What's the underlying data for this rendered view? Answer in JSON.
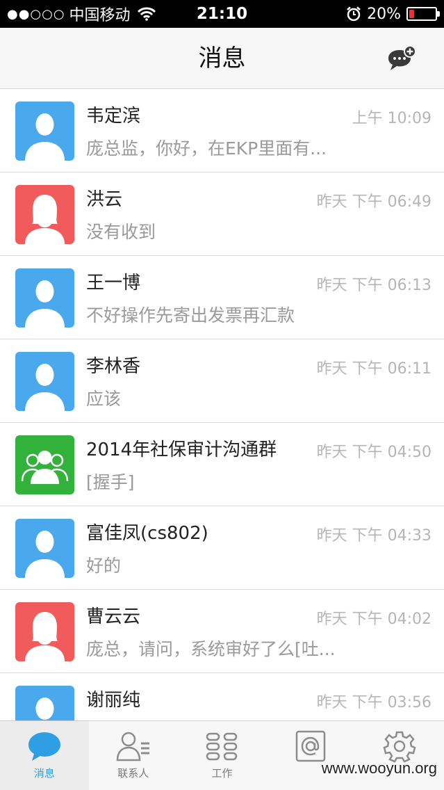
{
  "status_bar": {
    "signal": "●●○○○",
    "carrier": "中国移动",
    "time": "21:10",
    "battery_percent_text": "20%",
    "battery_level": 0.2,
    "battery_color": "#ff2a2a"
  },
  "header": {
    "title": "消息",
    "action_icon": "new-chat-icon"
  },
  "colors": {
    "avatar_blue": "#4aa9ec",
    "avatar_red": "#f25b5b",
    "avatar_green": "#32b23a",
    "tab_active": "#2f9fe4"
  },
  "conversations": [
    {
      "name": "韦定滨",
      "preview": "庞总监，你好，在EKP里面有...",
      "time": "上午 10:09",
      "avatar": "male-avatar-icon",
      "avatar_color": "#4aa9ec"
    },
    {
      "name": "洪云",
      "preview": "没有收到",
      "time": "昨天 下午 06:49",
      "avatar": "female-avatar-icon",
      "avatar_color": "#f25b5b"
    },
    {
      "name": "王一博",
      "preview": "不好操作先寄出发票再汇款",
      "time": "昨天 下午 06:13",
      "avatar": "male-avatar-icon",
      "avatar_color": "#4aa9ec"
    },
    {
      "name": "李林香",
      "preview": "应该",
      "time": "昨天 下午 06:11",
      "avatar": "male-avatar-icon",
      "avatar_color": "#4aa9ec"
    },
    {
      "name": "2014年社保审计沟通群",
      "preview": "[握手]",
      "time": "昨天 下午 04:50",
      "avatar": "group-avatar-icon",
      "avatar_color": "#32b23a"
    },
    {
      "name": "富佳凤(cs802)",
      "preview": "好的",
      "time": "昨天 下午 04:33",
      "avatar": "male-avatar-icon",
      "avatar_color": "#4aa9ec"
    },
    {
      "name": "曹云云",
      "preview": "庞总，请问，系统审好了么[吐...",
      "time": "昨天 下午 04:02",
      "avatar": "female-avatar-icon",
      "avatar_color": "#f25b5b"
    },
    {
      "name": "谢丽纯",
      "preview": "",
      "time": "昨天 下午 03:56",
      "avatar": "male-avatar-icon",
      "avatar_color": "#4aa9ec"
    }
  ],
  "tabs": [
    {
      "label": "消息",
      "icon": "chat-bubble-icon",
      "active": true
    },
    {
      "label": "联系人",
      "icon": "contacts-icon",
      "active": false
    },
    {
      "label": "工作",
      "icon": "apps-grid-icon",
      "active": false
    },
    {
      "label": "",
      "icon": "at-sign-icon",
      "active": false
    },
    {
      "label": "",
      "icon": "settings-gear-icon",
      "active": false
    }
  ],
  "watermark": "www.wooyun.org"
}
